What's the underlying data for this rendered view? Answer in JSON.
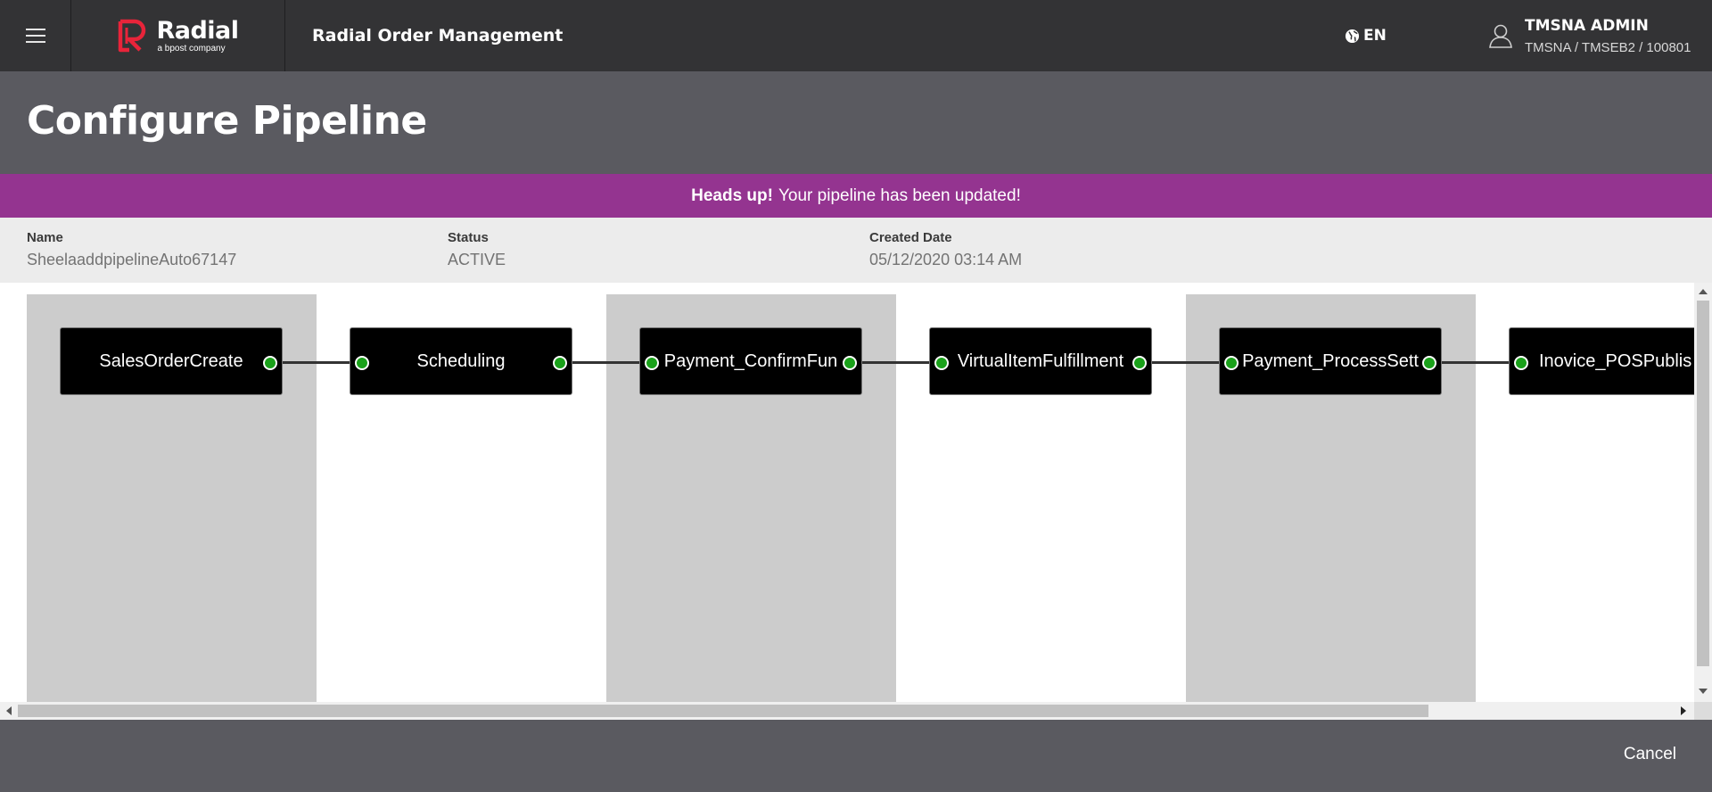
{
  "header": {
    "brand_name": "Radial",
    "brand_tagline": "a bpost company",
    "app_title": "Radial Order Management",
    "language": "EN",
    "user_name": "TMSNA ADMIN",
    "user_org": "TMSNA / TMSEB2 / 100801"
  },
  "page": {
    "title": "Configure Pipeline"
  },
  "alert": {
    "strong": "Heads up!",
    "message": "Your pipeline has been updated!",
    "color": "#943490"
  },
  "info": {
    "name_label": "Name",
    "name_value": "SheelaaddpipelineAuto67147",
    "status_label": "Status",
    "status_value": "ACTIVE",
    "created_label": "Created Date",
    "created_value": "05/12/2020 03:14 AM"
  },
  "pipeline": {
    "nodes": [
      {
        "label": "SalesOrderCreate"
      },
      {
        "label": "Scheduling"
      },
      {
        "label": "Payment_ConfirmFun"
      },
      {
        "label": "VirtualItemFulfillment"
      },
      {
        "label": "Payment_ProcessSett"
      },
      {
        "label": "Inovice_POSPublis"
      }
    ],
    "port_color": "#1aa11a"
  },
  "footer": {
    "cancel_label": "Cancel"
  }
}
